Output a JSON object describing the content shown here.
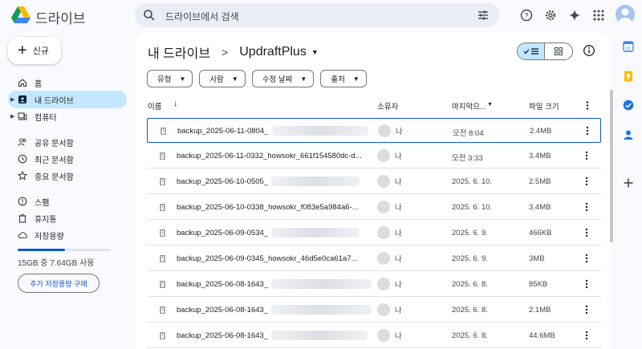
{
  "app": {
    "name": "드라이브"
  },
  "search": {
    "placeholder": "드라이브에서 검색"
  },
  "sidebar": {
    "new_label": "신규",
    "items": [
      {
        "label": "홈",
        "icon": "home-icon"
      },
      {
        "label": "내 드라이브",
        "icon": "my-drive-icon",
        "active": true
      },
      {
        "label": "컴퓨터",
        "icon": "computer-icon"
      },
      {
        "label": "공유 문서함",
        "icon": "shared-icon"
      },
      {
        "label": "최근 문서함",
        "icon": "recent-icon"
      },
      {
        "label": "중요 문서함",
        "icon": "starred-icon"
      },
      {
        "label": "스팸",
        "icon": "spam-icon"
      },
      {
        "label": "휴지통",
        "icon": "trash-icon"
      },
      {
        "label": "저장용량",
        "icon": "cloud-icon"
      }
    ],
    "storage_text": "15GB 중 7.64GB 사용",
    "storage_fraction": 0.51,
    "buy_storage_label": "추가 저장용량 구매"
  },
  "main": {
    "breadcrumb_root": "내 드라이브",
    "breadcrumb_separator": ">",
    "breadcrumb_current": "UpdraftPlus",
    "filters": [
      "유형",
      "사람",
      "수정 날짜",
      "출처"
    ],
    "columns": {
      "name": "이름",
      "owner": "소유자",
      "modified": "마지막으...",
      "size": "파일 크기"
    },
    "files": [
      {
        "name": "backup_2025-06-11-0804_",
        "owner": "나",
        "modified": "오전 8:04",
        "size": "2.4MB",
        "selected": true
      },
      {
        "name": "backup_2025-06-11-0332_howsokr_661f154580dc-d...",
        "owner": "나",
        "modified": "오전 3:33",
        "size": "3.4MB"
      },
      {
        "name": "backup_2025-06-10-0505_",
        "owner": "나",
        "modified": "2025. 6. 10.",
        "size": "2.5MB"
      },
      {
        "name": "backup_2025-06-10-0338_howsokr_f083e5a984a6-...",
        "owner": "나",
        "modified": "2025. 6. 10.",
        "size": "3.4MB"
      },
      {
        "name": "backup_2025-06-09-0534_",
        "owner": "나",
        "modified": "2025. 6. 9.",
        "size": "466KB"
      },
      {
        "name": "backup_2025-06-09-0345_howsokr_46d5e0ca61a7...",
        "owner": "나",
        "modified": "2025. 6. 9.",
        "size": "3MB"
      },
      {
        "name": "backup_2025-06-08-1643_",
        "owner": "나",
        "modified": "2025. 6. 8.",
        "size": "85KB"
      },
      {
        "name": "backup_2025-06-08-1643_",
        "owner": "나",
        "modified": "2025. 6. 8.",
        "size": "2.1MB"
      },
      {
        "name": "backup_2025-06-08-1643_",
        "owner": "나",
        "modified": "2025. 6. 8.",
        "size": "44.6MB"
      }
    ]
  },
  "colors": {
    "accent": "#0b57d0",
    "active_bg": "#c2e7ff",
    "background": "#f8fafd"
  }
}
